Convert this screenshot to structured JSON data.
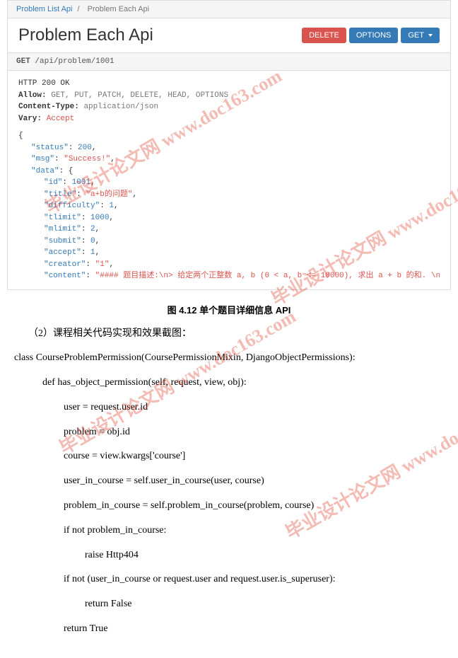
{
  "breadcrumb": {
    "link": "Problem List Api",
    "current": "Problem Each Api"
  },
  "title": "Problem Each Api",
  "buttons": {
    "delete": "DELETE",
    "options": "OPTIONS",
    "get": "GET"
  },
  "request": {
    "method": "GET",
    "path": "/api/problem/1001"
  },
  "response": {
    "status": "HTTP 200 OK",
    "allow_key": "Allow:",
    "allow_val": "GET, PUT, PATCH, DELETE, HEAD, OPTIONS",
    "ctype_key": "Content-Type:",
    "ctype_val": "application/json",
    "vary_key": "Vary:",
    "vary_val": "Accept"
  },
  "json": {
    "status_k": "\"status\"",
    "status_v": "200",
    "msg_k": "\"msg\"",
    "msg_v": "\"Success!\"",
    "data_k": "\"data\"",
    "id_k": "\"id\"",
    "id_v": "1001",
    "title_k": "\"title\"",
    "title_v": "\"a+b的问题\"",
    "diff_k": "\"difficulty\"",
    "diff_v": "1",
    "tlimit_k": "\"tlimit\"",
    "tlimit_v": "1000",
    "mlimit_k": "\"mlimit\"",
    "mlimit_v": "2",
    "submit_k": "\"submit\"",
    "submit_v": "0",
    "accept_k": "\"accept\"",
    "accept_v": "1",
    "creator_k": "\"creator\"",
    "creator_v": "\"1\"",
    "final_k": "\"content\"",
    "final_v": "\"#### 题目描述:\\n> 给定两个正整数 a, b (0 < a, b <= 10000), 求出 a + b 的和. \\n\\n#### 输入描述:\\n> 每行输入两个整"
  },
  "caption": "图 4.12 单个题目详细信息 API",
  "section_label": "（2）课程相关代码实现和效果截图：",
  "code": {
    "l1": "class CourseProblemPermission(CoursePermissionMixin, DjangoObjectPermissions):",
    "l2": "def has_object_permission(self, request, view, obj):",
    "l3": "user = request.user.id",
    "l4": "problem = obj.id",
    "l5": "course = view.kwargs['course']",
    "l6": "user_in_course = self.user_in_course(user, course)",
    "l7": "problem_in_course = self.problem_in_course(problem, course)",
    "l8": "if not problem_in_course:",
    "l9": "raise Http404",
    "l10": "if not (user_in_course or request.user and request.user.is_superuser):",
    "l11": "return False",
    "l12": "return True"
  },
  "watermark_text": "毕业设计论文网 www.doc163.com"
}
